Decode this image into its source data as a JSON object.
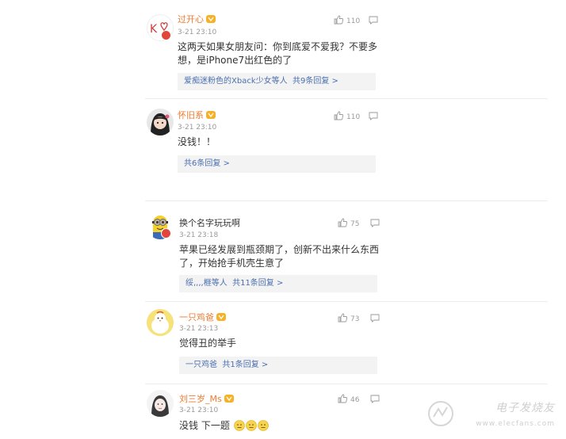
{
  "comments": [
    {
      "user": "过开心",
      "time": "3-21 23:10",
      "text_lines": [
        "这两天如果女朋友问：你到底爱不爱我？不要多",
        "想，是iPhone7出红色的了"
      ],
      "likes": "110",
      "replies_users": "爱痴迷粉色的Xback少女等人",
      "replies_count": "共9条回复 >"
    },
    {
      "user": "怀旧系",
      "time": "3-21 23:10",
      "text_lines": [
        "没钱！！"
      ],
      "likes": "110",
      "replies_users": "",
      "replies_count": "共6条回复 >"
    },
    {
      "user": "换个名字玩玩啊",
      "time": "3-21 23:18",
      "text_lines": [
        "苹果已经发展到瓶颈期了，创新不出来什么东西",
        "了，开始抢手机壳生意了"
      ],
      "likes": "75",
      "replies_users": "绥,,,,榧等人",
      "replies_count": "共11条回复 >"
    },
    {
      "user": "一只鸡爸",
      "time": "3-21 23:13",
      "text_lines": [
        "觉得丑的举手"
      ],
      "likes": "73",
      "replies_users": "一只鸡爸",
      "replies_count": "共1条回复 >"
    },
    {
      "user": "刘三岁_Ms",
      "time": "3-21 23:10",
      "text_lines": [
        "没钱 下一题"
      ],
      "likes": "46",
      "replies_users": "",
      "replies_count": ""
    }
  ],
  "watermark": {
    "title": "电子发烧友",
    "subtitle": "www.elecfans.com"
  },
  "colors": {
    "name_orange": "#ef7b2f",
    "reply_blue": "#4a6fb0",
    "meta_gray": "#9a9a9a",
    "reply_bg": "#f3f3f3"
  }
}
